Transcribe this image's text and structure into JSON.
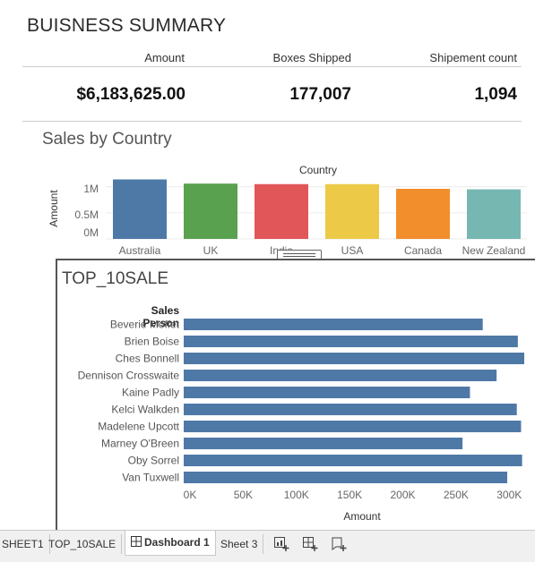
{
  "dashboard": {
    "title": "BUISNESS SUMMARY"
  },
  "kpis": [
    {
      "header": "Amount",
      "value": "$6,183,625.00"
    },
    {
      "header": "Boxes Shipped",
      "value": "177,007"
    },
    {
      "header": "Shipement count",
      "value": "1,094"
    }
  ],
  "country_chart": {
    "title": "Sales by Country",
    "xlabel": "Country",
    "ylabel": "Amount",
    "ticks": [
      "1M",
      "0.5M",
      "0M"
    ],
    "chart_data": {
      "type": "bar",
      "categories": [
        "Australia",
        "UK",
        "India",
        "USA",
        "Canada",
        "New Zealand"
      ],
      "values": [
        1140000,
        1060000,
        1050000,
        1050000,
        960000,
        950000
      ],
      "ylim": [
        0,
        1200000
      ],
      "colors": [
        "#4e79a7",
        "#59a14f",
        "#e15759",
        "#edc948",
        "#f28e2b",
        "#76b7b2"
      ]
    }
  },
  "top10_chart": {
    "title": "TOP_10SALE",
    "row_header": "Sales Person",
    "xlabel": "Amount",
    "xticks": [
      "0K",
      "50K",
      "100K",
      "150K",
      "200K",
      "250K",
      "300K"
    ],
    "chart_data": {
      "type": "bar",
      "orientation": "horizontal",
      "categories": [
        "Beverie Moffet",
        "Brien Boise",
        "Ches Bonnell",
        "Dennison Crosswaite",
        "Kaine Padly",
        "Kelci Walkden",
        "Madelene Upcott",
        "Marney O'Breen",
        "Oby Sorrel",
        "Van Tuxwell"
      ],
      "values": [
        281000,
        314000,
        320000,
        294000,
        269000,
        313000,
        317000,
        262000,
        318000,
        304000
      ],
      "xlim": [
        0,
        320000
      ],
      "color": "#4e79a7"
    }
  },
  "tabs": [
    {
      "label": "SHEET1",
      "icon": ""
    },
    {
      "label": "TOP_10SALE",
      "icon": ""
    },
    {
      "label": "Dashboard 1",
      "icon": "dashboard-icon"
    },
    {
      "label": "Sheet 3",
      "icon": ""
    }
  ],
  "tab_actions": [
    "new-worksheet-icon",
    "new-dashboard-icon",
    "new-story-icon"
  ]
}
